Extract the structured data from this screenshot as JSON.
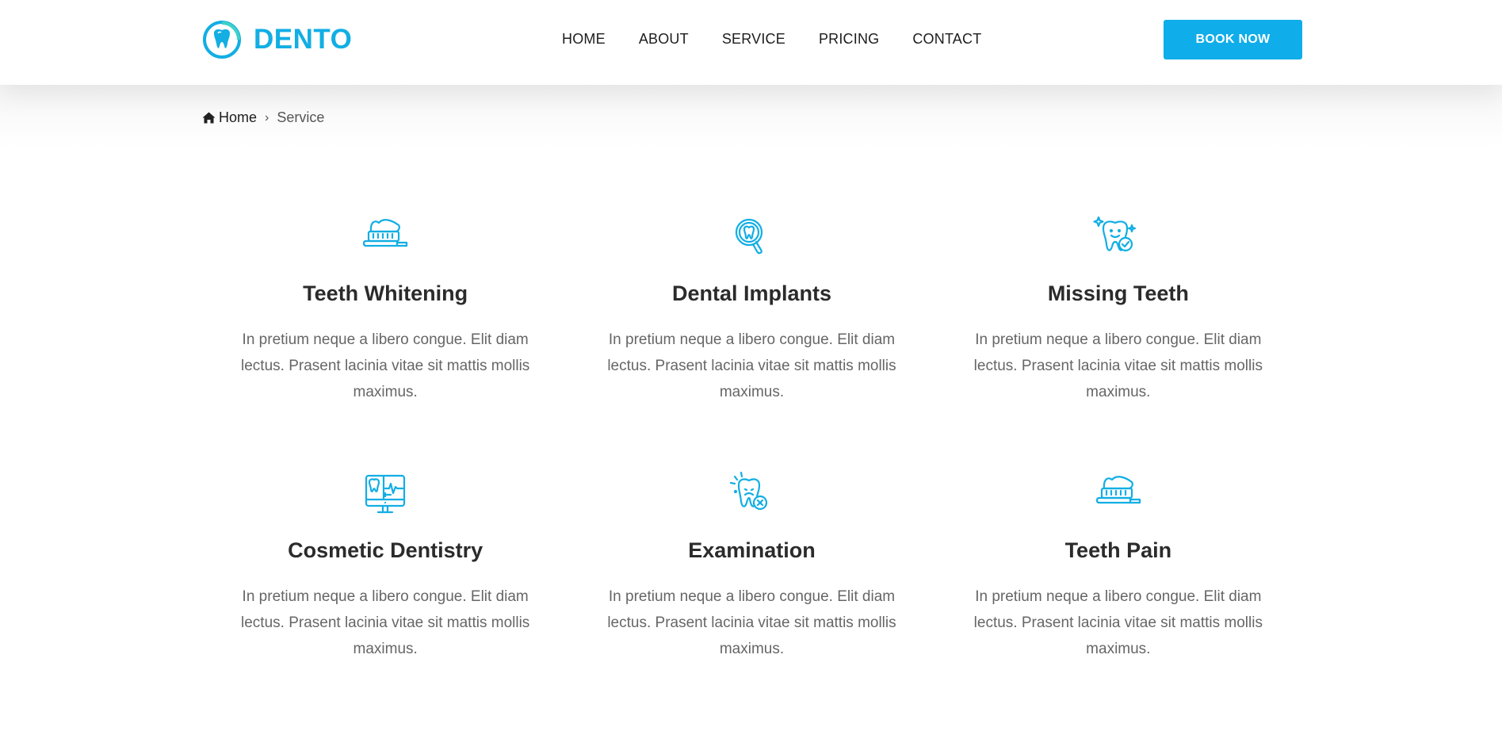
{
  "brand": {
    "name": "DENTO",
    "accent": "#0fade9"
  },
  "nav": {
    "items": [
      {
        "label": "HOME"
      },
      {
        "label": "ABOUT"
      },
      {
        "label": "SERVICE"
      },
      {
        "label": "PRICING"
      },
      {
        "label": "CONTACT"
      }
    ],
    "cta_label": "BOOK NOW"
  },
  "breadcrumb": {
    "home": "Home",
    "separator": "›",
    "current": "Service"
  },
  "services": [
    {
      "icon": "toothbrush-icon",
      "title": "Teeth Whitening",
      "desc": "In pretium neque a libero congue. Elit diam lectus. Prasent lacinia vitae sit mattis mollis maximus."
    },
    {
      "icon": "tooth-magnifier-icon",
      "title": "Dental Implants",
      "desc": "In pretium neque a libero congue. Elit diam lectus. Prasent lacinia vitae sit mattis mollis maximus."
    },
    {
      "icon": "happy-tooth-icon",
      "title": "Missing Teeth",
      "desc": "In pretium neque a libero congue. Elit diam lectus. Prasent lacinia vitae sit mattis mollis maximus."
    },
    {
      "icon": "dental-monitor-icon",
      "title": "Cosmetic Dentistry",
      "desc": "In pretium neque a libero congue. Elit diam lectus. Prasent lacinia vitae sit mattis mollis maximus."
    },
    {
      "icon": "broken-tooth-icon",
      "title": "Examination",
      "desc": "In pretium neque a libero congue. Elit diam lectus. Prasent lacinia vitae sit mattis mollis maximus."
    },
    {
      "icon": "toothbrush-icon",
      "title": "Teeth Pain",
      "desc": "In pretium neque a libero congue. Elit diam lectus. Prasent lacinia vitae sit mattis mollis maximus."
    }
  ]
}
